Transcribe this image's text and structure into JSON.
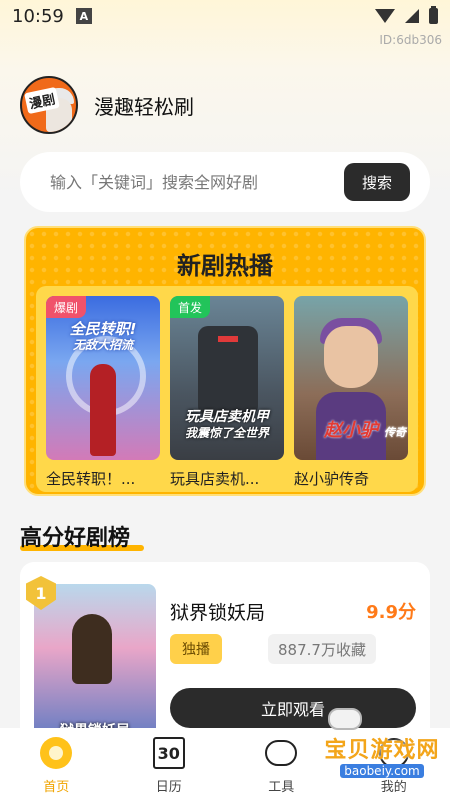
{
  "status_bar": {
    "time": "10:59",
    "notification_icon": "A"
  },
  "device_id": "ID:6db306",
  "header": {
    "logo_text": "漫剧",
    "app_name": "漫趣轻松刷"
  },
  "search": {
    "placeholder": "输入「关键词」搜索全网好剧",
    "button_label": "搜索"
  },
  "hot_section": {
    "title": "新剧热播",
    "cards": [
      {
        "badge": "爆剧",
        "badge_color": "#f0526b",
        "poster_text": "全民转职!",
        "poster_sub": "无敌大招流",
        "title": "全民转职！..."
      },
      {
        "badge": "首发",
        "badge_color": "#22c45a",
        "poster_text": "玩具店卖机甲",
        "poster_sub": "我震惊了全世界",
        "title": "玩具店卖机..."
      },
      {
        "badge": "",
        "poster_text": "赵小驴",
        "poster_sub": "传奇",
        "title": "赵小驴传奇"
      }
    ]
  },
  "ranking": {
    "title": "高分好剧榜",
    "item": {
      "rank": "1",
      "cover_title": "狱界锁妖局",
      "name": "狱界锁妖局",
      "score": "9.9分",
      "tag": "独播",
      "favorites": "887.7万收藏",
      "watch_label": "立即观看"
    }
  },
  "bottom_nav": {
    "items": [
      {
        "label": "首页",
        "icon": "home-icon",
        "active": true
      },
      {
        "label": "日历",
        "icon": "calendar-icon",
        "calendar_day": "30",
        "active": false
      },
      {
        "label": "工具",
        "icon": "tools-icon",
        "active": false
      },
      {
        "label": "我的",
        "icon": "profile-icon",
        "active": false
      }
    ]
  },
  "watermark": {
    "main": "宝贝游戏网",
    "sub": "baobeiy.com"
  },
  "colors": {
    "accent": "#ffb400",
    "score": "#ff7a18",
    "dark_button": "#2b2b2b"
  }
}
